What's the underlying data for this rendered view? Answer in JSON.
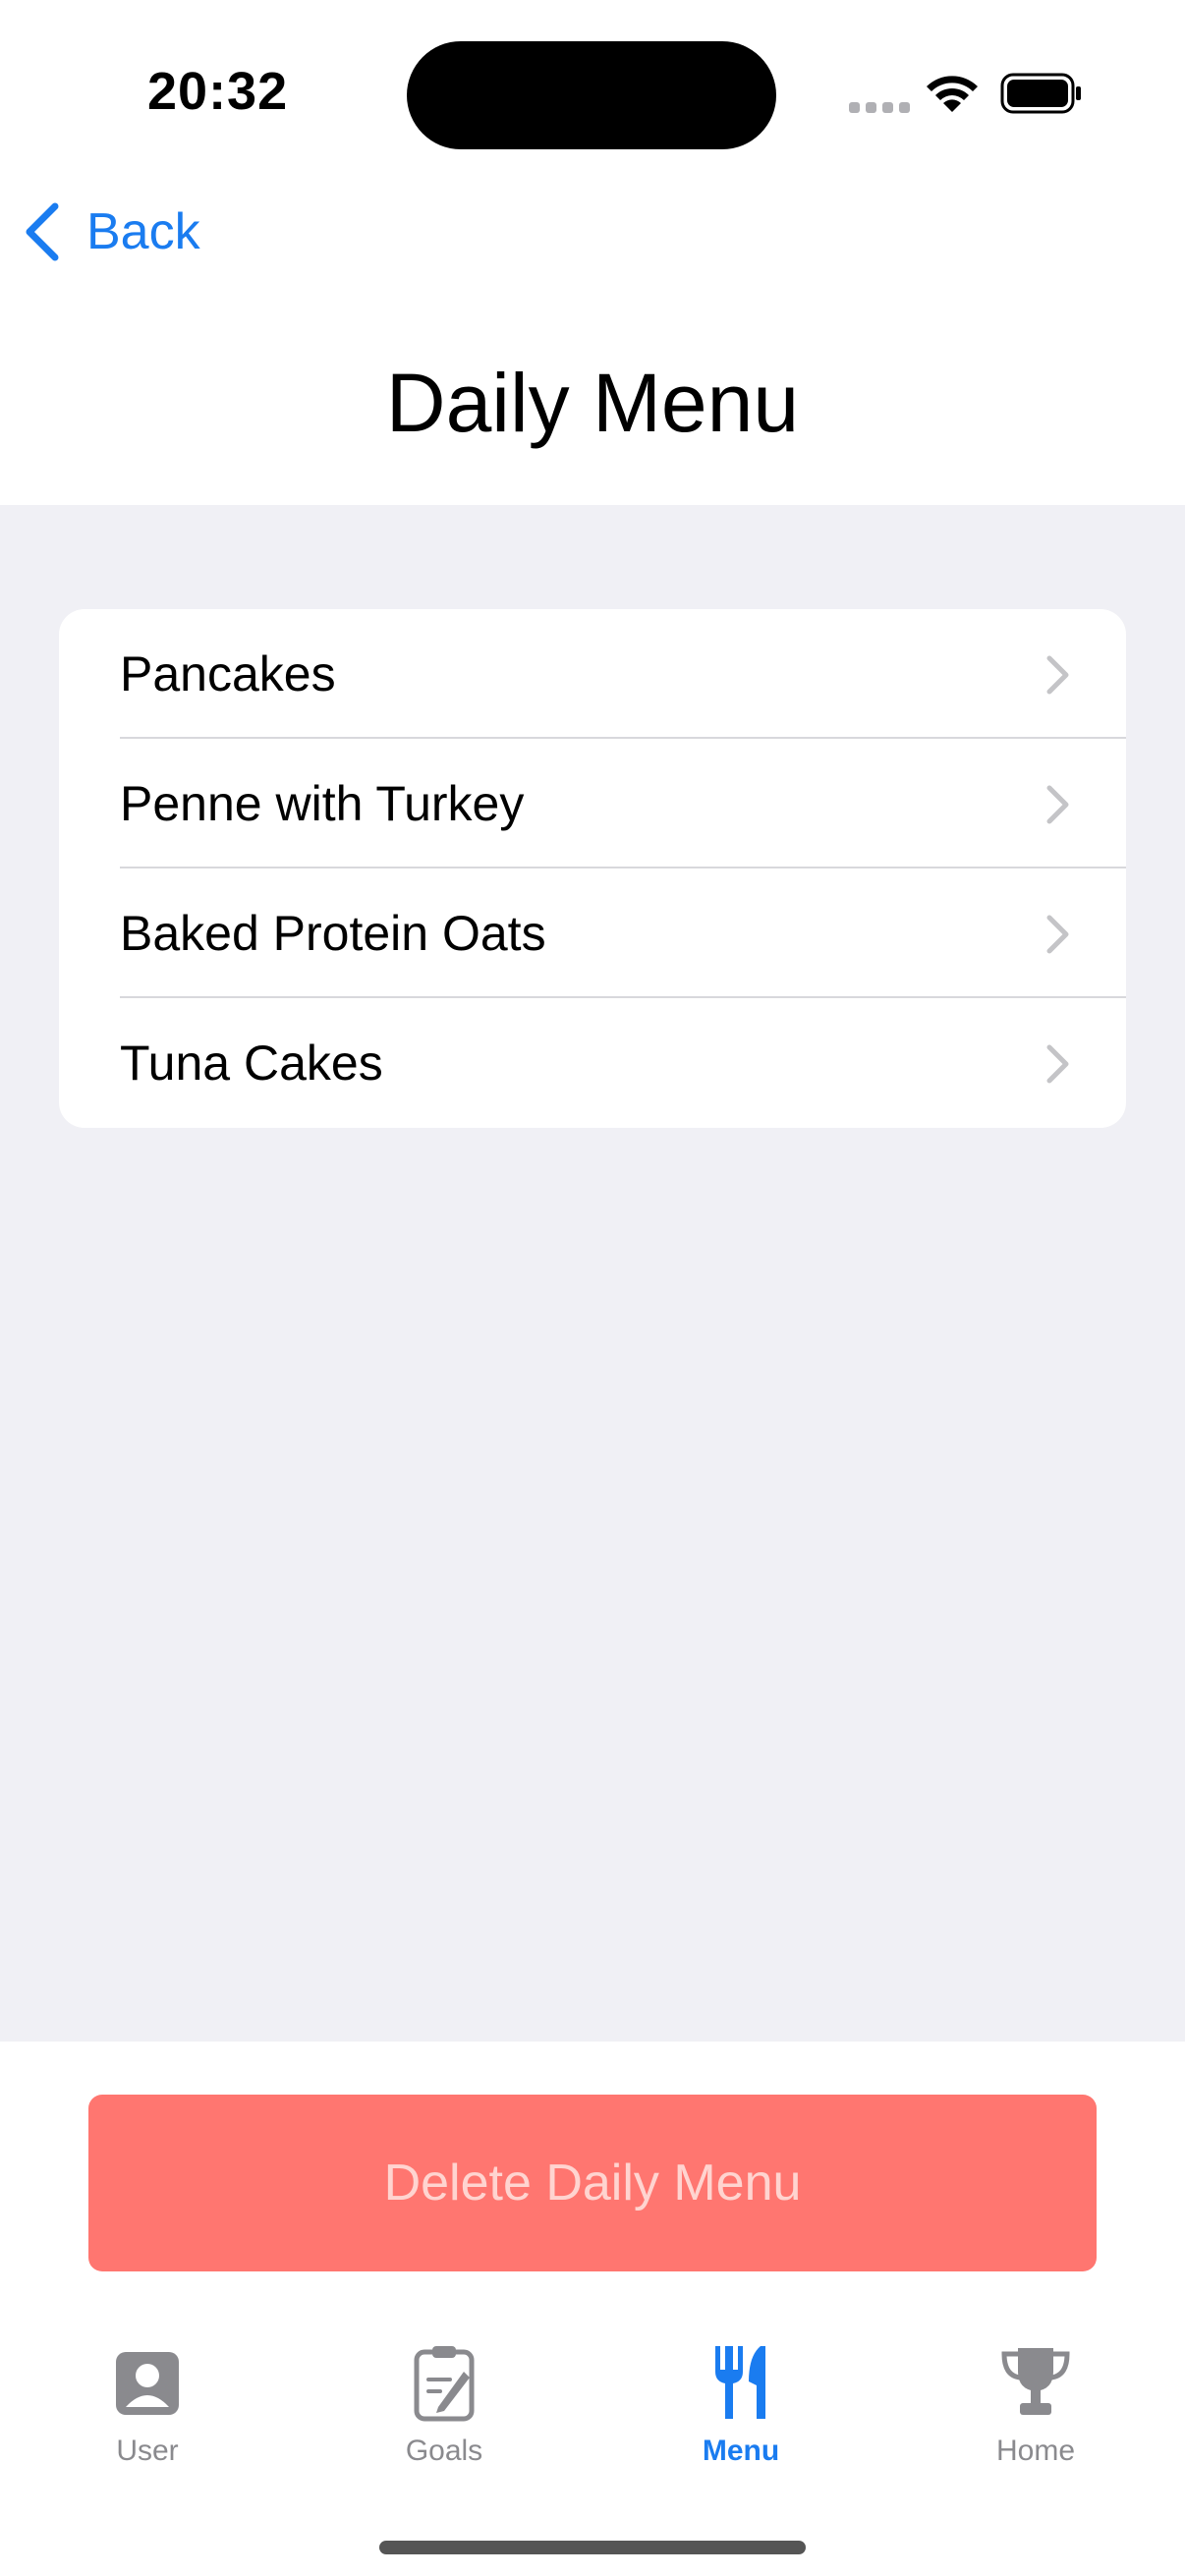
{
  "status_bar": {
    "time": "20:32"
  },
  "nav": {
    "back_label": "Back",
    "title": "Daily Menu"
  },
  "menu_items": [
    {
      "label": "Pancakes"
    },
    {
      "label": "Penne with Turkey"
    },
    {
      "label": "Baked Protein Oats"
    },
    {
      "label": "Tuna Cakes"
    }
  ],
  "delete_button": {
    "label": "Delete Daily Menu"
  },
  "tabs": [
    {
      "label": "User",
      "icon": "user-icon"
    },
    {
      "label": "Goals",
      "icon": "clipboard-icon"
    },
    {
      "label": "Menu",
      "icon": "fork-knife-icon",
      "active": true
    },
    {
      "label": "Home",
      "icon": "trophy-icon"
    }
  ],
  "colors": {
    "accent": "#1a7cf0",
    "delete_bg": "#ff7670",
    "delete_text": "#ffd4d0",
    "background": "#f0f0f5",
    "inactive_tab": "#8a8a8e"
  }
}
